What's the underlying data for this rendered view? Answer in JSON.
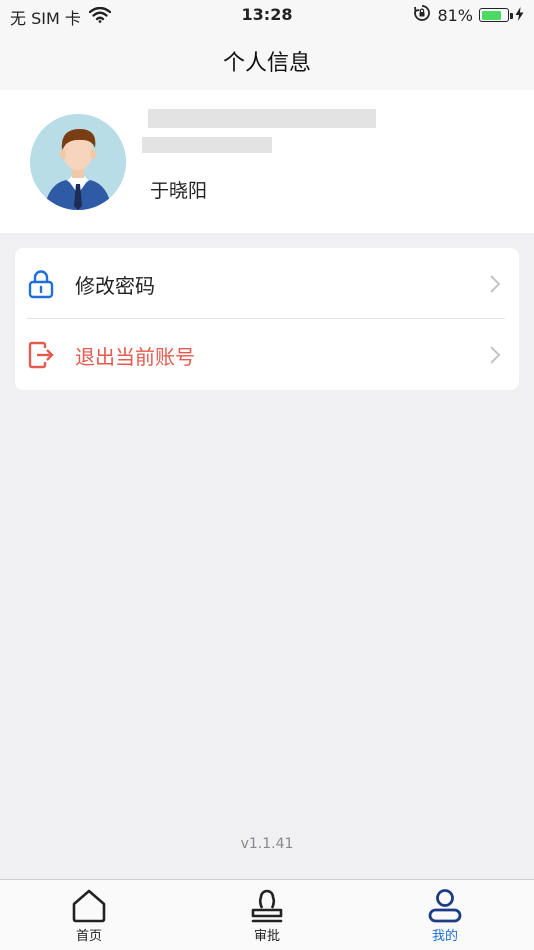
{
  "status_bar": {
    "carrier": "无 SIM 卡",
    "time": "13:28",
    "battery_percent": "81%",
    "battery_level": 0.81,
    "icons": [
      "wifi-icon",
      "rotation-lock-icon",
      "battery-icon",
      "charging-bolt-icon"
    ]
  },
  "nav": {
    "title": "个人信息"
  },
  "profile": {
    "name": "于晓阳",
    "avatar_icon": "user-avatar-icon"
  },
  "menu": {
    "items": [
      {
        "label": "修改密码",
        "icon": "lock-icon",
        "color": "#222222",
        "icon_color": "#1e6fd9"
      },
      {
        "label": "退出当前账号",
        "icon": "logout-icon",
        "color": "#e55a4f",
        "icon_color": "#e55a4f"
      }
    ]
  },
  "version": "v1.1.41",
  "tab_bar": {
    "tabs": [
      {
        "label": "首页",
        "icon": "home-icon",
        "active": false
      },
      {
        "label": "审批",
        "icon": "approval-stamp-icon",
        "active": false
      },
      {
        "label": "我的",
        "icon": "profile-icon",
        "active": true
      }
    ],
    "active_color": "#1e6fd9"
  }
}
